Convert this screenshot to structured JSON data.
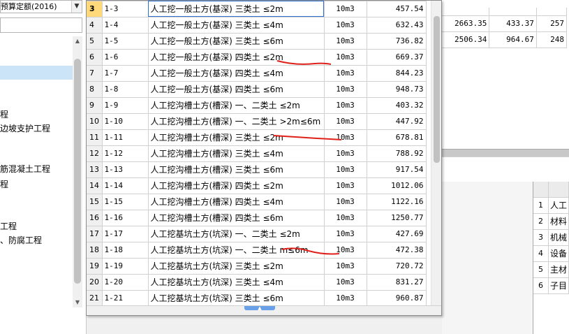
{
  "left_panel": {
    "quota_combo_value": "预算定额(2016)",
    "tree_items": [
      {
        "label": "",
        "selected": true
      },
      {
        "label": "程",
        "selected": false
      },
      {
        "label": "边坡支护工程",
        "selected": false
      },
      {
        "label": "筋混凝土工程",
        "selected": false
      },
      {
        "label": "程",
        "selected": false
      },
      {
        "label": "工程",
        "selected": false
      },
      {
        "label": "、防腐工程",
        "selected": false
      }
    ]
  },
  "quota_table": {
    "rows": [
      {
        "num": "3",
        "code": "1-3",
        "name": "人工挖一般土方(基深) 三类土 ≤2m",
        "unit": "10m3",
        "price": "457.54",
        "current": true
      },
      {
        "num": "4",
        "code": "1-4",
        "name": "人工挖一般土方(基深) 三类土 ≤4m",
        "unit": "10m3",
        "price": "632.43"
      },
      {
        "num": "5",
        "code": "1-5",
        "name": "人工挖一般土方(基深) 三类土 ≤6m",
        "unit": "10m3",
        "price": "736.82"
      },
      {
        "num": "6",
        "code": "1-6",
        "name": "人工挖一般土方(基深) 四类土 ≤2m",
        "unit": "10m3",
        "price": "669.37"
      },
      {
        "num": "7",
        "code": "1-7",
        "name": "人工挖一般土方(基深) 四类土 ≤4m",
        "unit": "10m3",
        "price": "844.23"
      },
      {
        "num": "8",
        "code": "1-8",
        "name": "人工挖一般土方(基深) 四类土 ≤6m",
        "unit": "10m3",
        "price": "948.73"
      },
      {
        "num": "9",
        "code": "1-9",
        "name": "人工挖沟槽土方(槽深) 一、二类土 ≤2m",
        "unit": "10m3",
        "price": "403.32"
      },
      {
        "num": "10",
        "code": "1-10",
        "name": "人工挖沟槽土方(槽深) 一、二类土 >2m≤6m",
        "unit": "10m3",
        "price": "447.92"
      },
      {
        "num": "11",
        "code": "1-11",
        "name": "人工挖沟槽土方(槽深) 三类土 ≤2m",
        "unit": "10m3",
        "price": "678.81"
      },
      {
        "num": "12",
        "code": "1-12",
        "name": "人工挖沟槽土方(槽深) 三类土 ≤4m",
        "unit": "10m3",
        "price": "788.92"
      },
      {
        "num": "13",
        "code": "1-13",
        "name": "人工挖沟槽土方(槽深) 三类土 ≤6m",
        "unit": "10m3",
        "price": "917.54"
      },
      {
        "num": "14",
        "code": "1-14",
        "name": "人工挖沟槽土方(槽深) 四类土 ≤2m",
        "unit": "10m3",
        "price": "1012.06"
      },
      {
        "num": "15",
        "code": "1-15",
        "name": "人工挖沟槽土方(槽深) 四类土 ≤4m",
        "unit": "10m3",
        "price": "1122.16"
      },
      {
        "num": "16",
        "code": "1-16",
        "name": "人工挖沟槽土方(槽深) 四类土 ≤6m",
        "unit": "10m3",
        "price": "1250.77"
      },
      {
        "num": "17",
        "code": "1-17",
        "name": "人工挖基坑土方(坑深) 一、二类土 ≤2m",
        "unit": "10m3",
        "price": "427.69"
      },
      {
        "num": "18",
        "code": "1-18",
        "name": "人工挖基坑土方(坑深) 一、二类土 m≤6m",
        "unit": "10m3",
        "price": "472.38"
      },
      {
        "num": "19",
        "code": "1-19",
        "name": "人工挖基坑土方(坑深) 三类土 ≤2m",
        "unit": "10m3",
        "price": "720.72"
      },
      {
        "num": "20",
        "code": "1-20",
        "name": "人工挖基坑土方(坑深) 三类土 ≤4m",
        "unit": "10m3",
        "price": "831.27"
      },
      {
        "num": "21",
        "code": "1-21",
        "name": "人工挖基坑土方(坑深) 三类土 ≤6m",
        "unit": "10m3",
        "price": "960.87"
      }
    ]
  },
  "right_top": {
    "rows": [
      [
        "2663.35",
        "433.37",
        "257"
      ],
      [
        "2506.34",
        "964.67",
        "248"
      ]
    ]
  },
  "right_lower": {
    "rows": [
      {
        "num": "1",
        "text": "人工"
      },
      {
        "num": "2",
        "text": "材料"
      },
      {
        "num": "3",
        "text": "机械"
      },
      {
        "num": "4",
        "text": "设备"
      },
      {
        "num": "5",
        "text": "主材"
      },
      {
        "num": "6",
        "text": "子目"
      }
    ]
  },
  "colors": {
    "annotation": "#e0201a",
    "current_row_marker": "#ffd97a",
    "selection": "#cce4f7",
    "cell_outline": "#2f6fd0"
  }
}
